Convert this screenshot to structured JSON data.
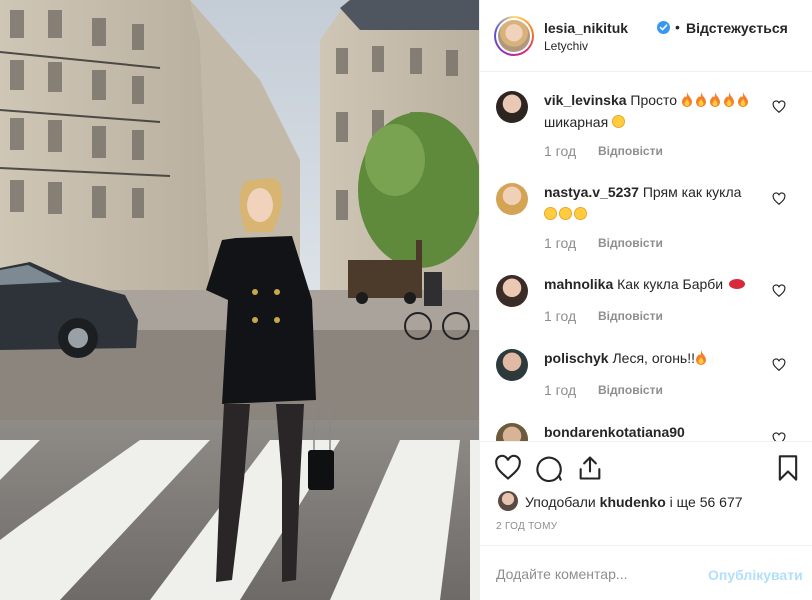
{
  "post": {
    "photo_alt": "",
    "author": {
      "username": "lesia_nikituk",
      "verified_icon": "verified-badge-icon",
      "separator": "•",
      "follow_label": "Відстежується",
      "location": "Letychiv"
    }
  },
  "comments": [
    {
      "username": "vik_levinska",
      "text": "Просто",
      "emoji_after": [
        "fire",
        "fire",
        "fire",
        "fire",
        "fire"
      ],
      "line2": "шикарная",
      "line2_emoji": [
        "heart-eyes"
      ],
      "time": "1 год",
      "reply": "Відповісти"
    },
    {
      "username": "nastya.v_5237",
      "text": "Прям как кукла",
      "line2": "",
      "line2_emoji": [
        "heart-eyes",
        "heart-eyes",
        "heart-eyes"
      ],
      "time": "1 год",
      "reply": "Відповісти"
    },
    {
      "username": "mahnolika",
      "text": "Как кукла Барби",
      "emoji_after": [
        "lips"
      ],
      "time": "1 год",
      "reply": "Відповісти"
    },
    {
      "username": "polischyk",
      "text": "Леся, огонь!!",
      "emoji_after": [
        "fire"
      ],
      "time": "1 год",
      "reply": "Відповісти"
    },
    {
      "username": "bondarenkotatiana90",
      "text": ""
    }
  ],
  "actions": {
    "like_icon": "heart-icon",
    "comment_icon": "comment-icon",
    "share_icon": "share-icon",
    "save_icon": "bookmark-icon"
  },
  "likes": {
    "prefix": "Уподобали",
    "user": "khudenko",
    "suffix": "і ще 56 677"
  },
  "timestamp": "2 ГОД ТОМУ",
  "comment_box": {
    "placeholder": "Додайте коментар...",
    "publish_label": "Опублікувати"
  },
  "colors": {
    "accent": "#3897f0",
    "publish_disabled": "#b2dffc",
    "muted_text": "#8e8e8e",
    "text": "#262626"
  }
}
